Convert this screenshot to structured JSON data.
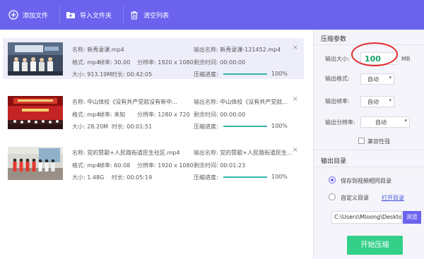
{
  "toolbar": {
    "add_file": "添加文件",
    "import_folder": "导入文件夹",
    "clear_list": "清空列表"
  },
  "labels": {
    "name": "名称:",
    "format": "格式:",
    "framerate": "帧率:",
    "resolution": "分辨率:",
    "size": "大小:",
    "duration": "时长:",
    "output_name": "输出名称:",
    "remaining": "剩余时间:",
    "progress": "压缩进度:"
  },
  "files": [
    {
      "name": "新秀录课.mp4",
      "format": "mp4",
      "framerate": "30.00",
      "resolution": "1920 x 1080",
      "size": "913.19M",
      "duration": "00:42:05",
      "output_name": "新秀录课-121452.mp4",
      "remaining": "00:00:00",
      "progress_text": "100%",
      "progress": 1.0
    },
    {
      "name": "中山体校《没有共产党就没有新中...",
      "format": "mp4",
      "framerate": "未知",
      "resolution": "1280 x 720",
      "size": "28.20M",
      "duration": "00:01:51",
      "output_name": "中山体校《没有共产党就...",
      "remaining": "00:00:00",
      "progress_text": "100%",
      "progress": 1.0
    },
    {
      "name": "党的赞歌+人民路街道民生社区.mp4",
      "format": "mp4",
      "framerate": "60.08",
      "resolution": "1920 x 1080",
      "size": "1.48G",
      "duration": "00:05:19",
      "output_name": "党的赞歌+人民路街道民生...",
      "remaining": "00:01:23",
      "progress_text": "100%",
      "progress": 1.0
    }
  ],
  "panel": {
    "compress_title": "压缩参数",
    "output_size_label": "输出大小:",
    "output_size_value": "100",
    "output_size_unit": "MB",
    "output_format_label": "输出格式:",
    "output_format_value": "自动",
    "output_framerate_label": "输出帧率:",
    "output_framerate_value": "自动",
    "output_resolution_label": "输出分辨率:",
    "output_resolution_value": "自动",
    "compat_label": "兼容性强",
    "output_dir_title": "输出目录",
    "save_same_dir": "保存到视频相同目录",
    "custom_dir": "自定义目录",
    "open_dir": "打开目录",
    "path": "C:\\Users\\Mloong\\Desktop",
    "browse": "浏览",
    "start": "开始压缩"
  },
  "colors": {
    "accent": "#6b63ee",
    "start_button": "#34d08a",
    "progress": "#33b6a8",
    "highlight_ring": "#e42a2a"
  }
}
